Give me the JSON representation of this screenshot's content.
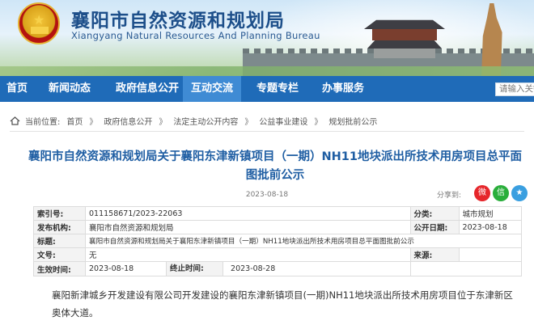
{
  "header": {
    "title": "襄阳市自然资源和规划局",
    "subtitle": "Xiangyang Natural Resources And Planning Bureau",
    "emblem_icon": "national-emblem-icon"
  },
  "nav": {
    "items": [
      {
        "label": "首页"
      },
      {
        "label": "新闻动态"
      },
      {
        "label": "政府信息公开"
      },
      {
        "label": "互动交流"
      },
      {
        "label": "专题专栏"
      },
      {
        "label": "办事服务"
      }
    ],
    "active_index": 3,
    "search_placeholder": "请输入关键"
  },
  "breadcrumb": {
    "prefix": "当前位置:",
    "items": [
      "首页",
      "政府信息公开",
      "法定主动公开内容",
      "公益事业建设",
      "规划批前公示"
    ],
    "separator": "》"
  },
  "article": {
    "title": "襄阳市自然资源和规划局关于襄阳东津新镇项目（一期）NH11地块派出所技术用房项目总平面图批前公示",
    "date": "2023-08-18",
    "share_label": "分享到:",
    "body": "襄阳新津城乡开发建设有限公司开发建设的襄阳东津新镇项目(一期)NH11地块派出所技术用房项目位于东津新区奥体大道。"
  },
  "info_table": {
    "index_label": "索引号:",
    "index_value": "011158671/2023-22063",
    "category_label": "分类:",
    "category_value": "城市规划",
    "publisher_label": "发布机构:",
    "publisher_value": "襄阳市自然资源和规划局",
    "publish_date_label": "公开日期:",
    "publish_date_value": "2023-08-18",
    "title_label": "标题:",
    "title_value": "襄阳市自然资源和规划局关于襄阳东津新镇项目（一期）NH11地块派出所技术用房项目总平面图批前公示",
    "doc_no_label": "文号:",
    "doc_no_value": "无",
    "source_label": "来源:",
    "source_value": "",
    "effective_label": "生效时间:",
    "effective_value": "2023-08-18",
    "end_label": "终止时间:",
    "end_value": "2023-08-28"
  },
  "colors": {
    "nav_bg": "#1f6bb8",
    "nav_active": "#3f8bd4",
    "title_blue": "#1f5ea3"
  }
}
